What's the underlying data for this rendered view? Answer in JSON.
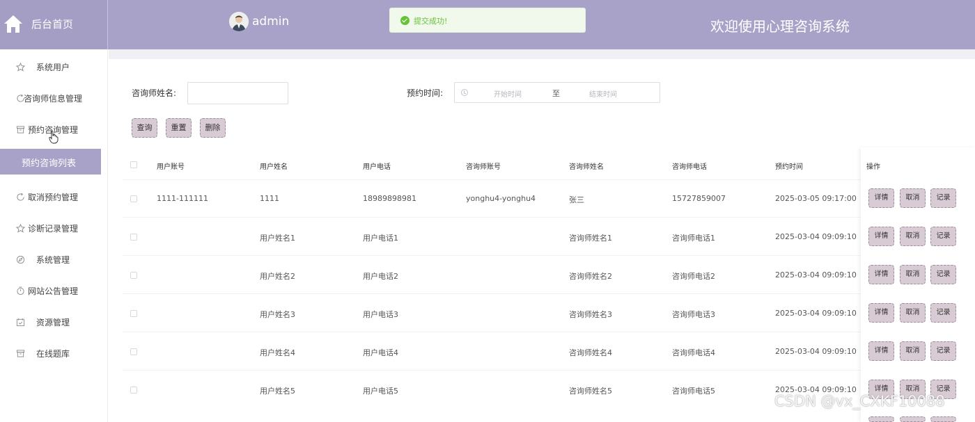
{
  "header": {
    "home_label": "后台首页",
    "username": "admin",
    "site_title": "欢迎使用心理咨询系统"
  },
  "toast": {
    "message": "提交成功!"
  },
  "sidebar": {
    "items": [
      {
        "label": "系统用户",
        "icon": "star-icon"
      },
      {
        "label": "咨询师信息管理",
        "icon": "refresh-icon"
      },
      {
        "label": "预约咨询管理",
        "icon": "box-icon"
      },
      {
        "label": "取消预约管理",
        "icon": "refresh-icon"
      },
      {
        "label": "诊断记录管理",
        "icon": "star-icon"
      },
      {
        "label": "系统管理",
        "icon": "compass-icon"
      },
      {
        "label": "网站公告管理",
        "icon": "clock-icon"
      },
      {
        "label": "资源管理",
        "icon": "calendar-check-icon"
      },
      {
        "label": "在线题库",
        "icon": "box-icon"
      }
    ],
    "active_sub": "预约咨询列表"
  },
  "filters": {
    "counselor_name_label": "咨询师姓名:",
    "counselor_name_value": "",
    "appointment_time_label": "预约时间:",
    "start_placeholder": "开始时间",
    "range_separator": "至",
    "end_placeholder": "结束时间"
  },
  "actions": {
    "search": "查询",
    "reset": "重置",
    "delete": "删除"
  },
  "table": {
    "headers": [
      "用户账号",
      "用户姓名",
      "用户电话",
      "咨询师账号",
      "咨询师姓名",
      "咨询师电话",
      "预约时间",
      "操作"
    ],
    "rows": [
      {
        "account": "1111-111111",
        "name": "1111",
        "phone": "18989898981",
        "c_account": "yonghu4-yonghu4",
        "c_name": "张三",
        "c_phone": "15727859007",
        "time": "2025-03-05 09:17:00"
      },
      {
        "account": "",
        "name": "用户姓名1",
        "phone": "用户电话1",
        "c_account": "",
        "c_name": "咨询师姓名1",
        "c_phone": "咨询师电话1",
        "time": "2025-03-04 09:09:10"
      },
      {
        "account": "",
        "name": "用户姓名2",
        "phone": "用户电话2",
        "c_account": "",
        "c_name": "咨询师姓名2",
        "c_phone": "咨询师电话2",
        "time": "2025-03-04 09:09:10"
      },
      {
        "account": "",
        "name": "用户姓名3",
        "phone": "用户电话3",
        "c_account": "",
        "c_name": "咨询师姓名3",
        "c_phone": "咨询师电话3",
        "time": "2025-03-04 09:09:10"
      },
      {
        "account": "",
        "name": "用户姓名4",
        "phone": "用户电话4",
        "c_account": "",
        "c_name": "咨询师姓名4",
        "c_phone": "咨询师电话4",
        "time": "2025-03-04 09:09:10"
      },
      {
        "account": "",
        "name": "用户姓名5",
        "phone": "用户电话5",
        "c_account": "",
        "c_name": "咨询师姓名5",
        "c_phone": "咨询师电话5",
        "time": "2025-03-04 09:09:10"
      }
    ],
    "row_actions": {
      "detail": "详情",
      "cancel": "取消",
      "record": "记录"
    }
  },
  "watermark": "CSDN @vx_CXKF10088",
  "colors": {
    "accent": "#a9a2c8",
    "button_bg": "#d8cbd3",
    "success": "#67c23a"
  }
}
